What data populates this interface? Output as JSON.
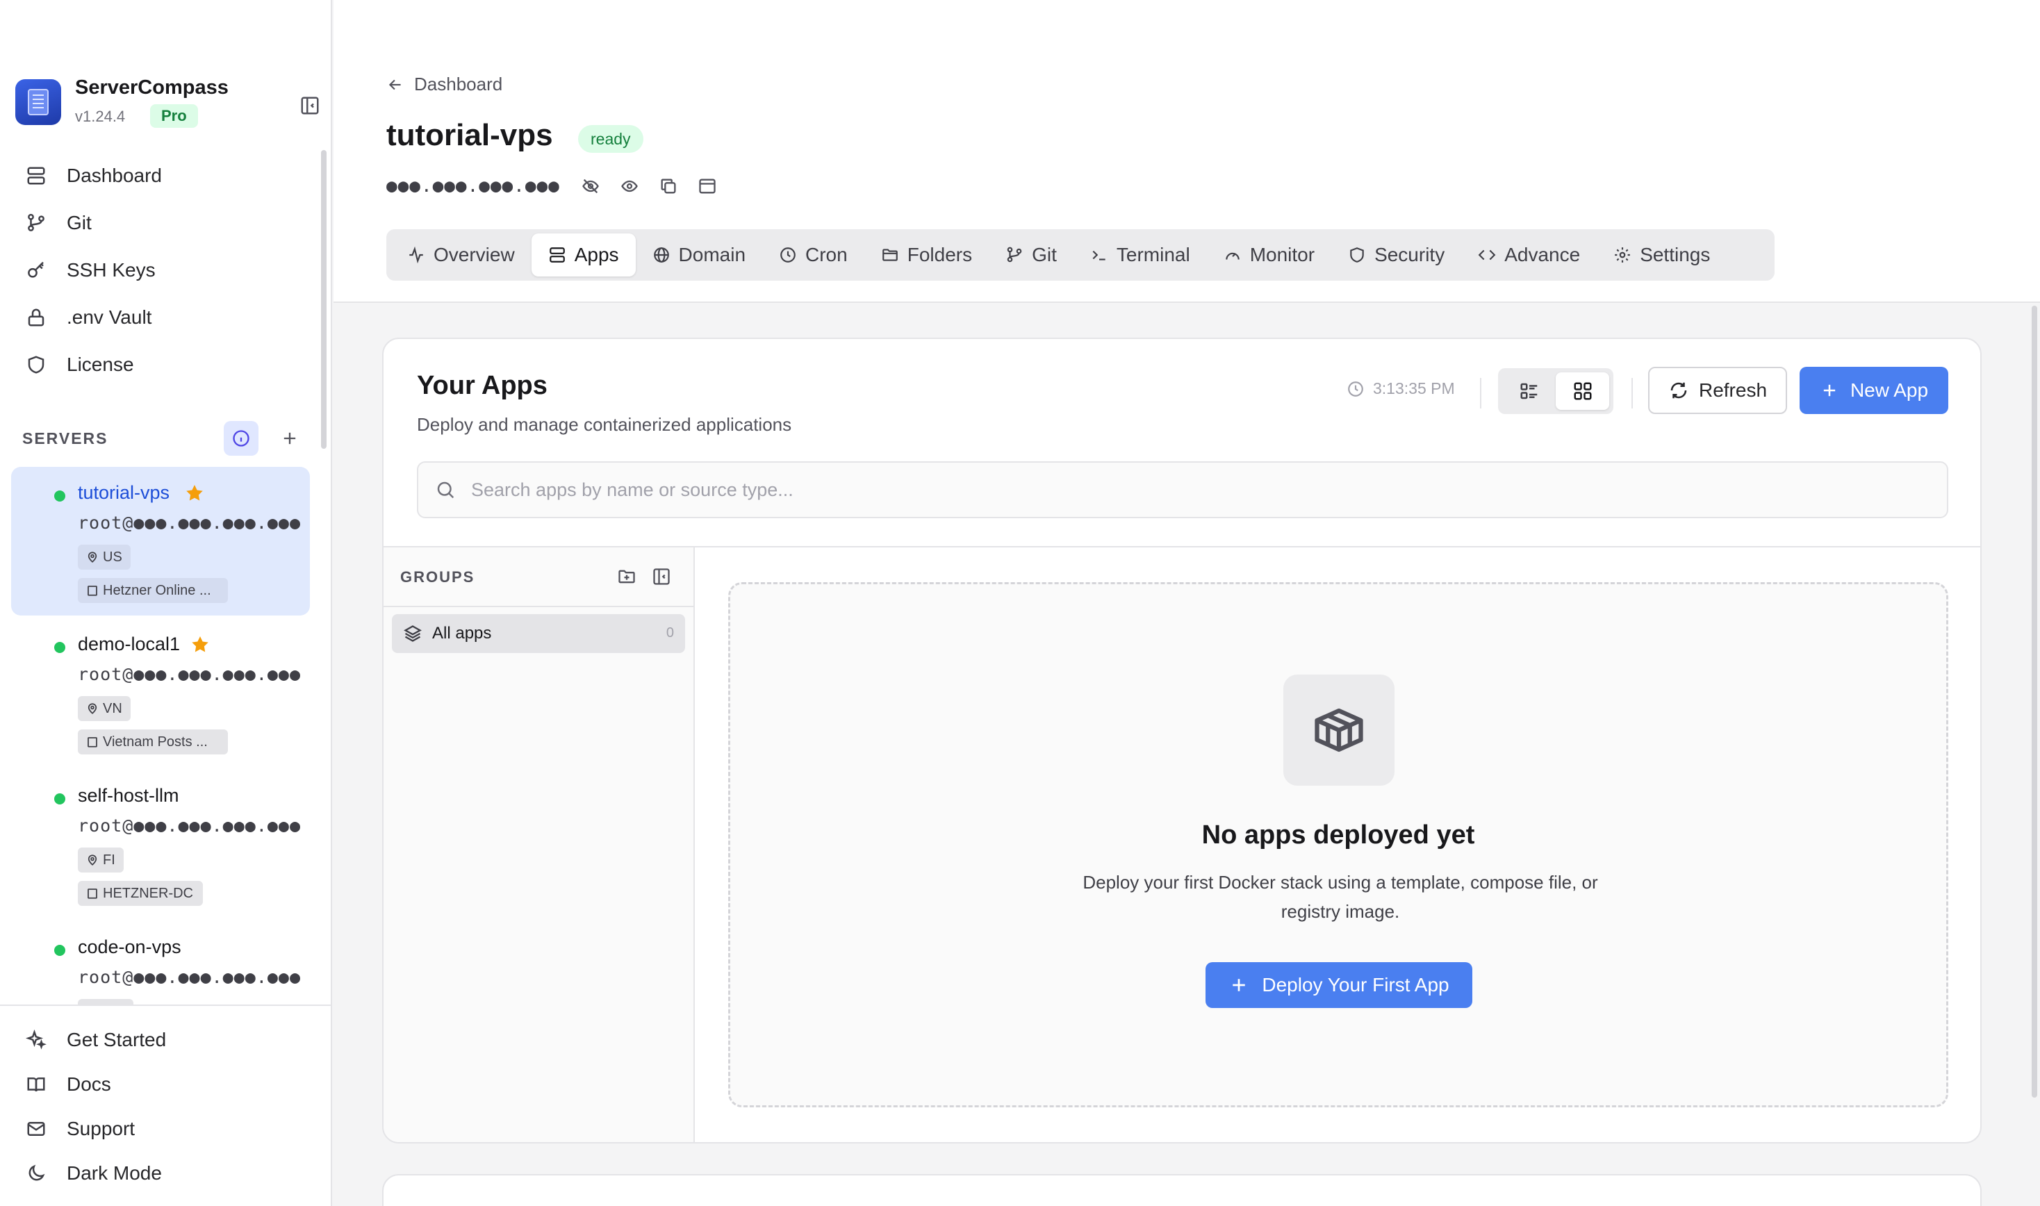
{
  "brand": {
    "name": "ServerCompass",
    "version": "v1.24.4",
    "plan": "Pro"
  },
  "nav": [
    {
      "label": "Dashboard",
      "icon": "server-icon"
    },
    {
      "label": "Git",
      "icon": "git-branch-icon"
    },
    {
      "label": "SSH Keys",
      "icon": "key-icon"
    },
    {
      "label": ".env Vault",
      "icon": "lock-icon"
    },
    {
      "label": "License",
      "icon": "shield-icon"
    }
  ],
  "servers_section": {
    "label": "SERVERS"
  },
  "servers": [
    {
      "name": "tutorial-vps",
      "user": "root@●●●.●●●.●●●.●●●",
      "location": "US",
      "provider": "Hetzner Online ...",
      "starred": true,
      "active": true
    },
    {
      "name": "demo-local1",
      "user": "root@●●●.●●●.●●●.●●●",
      "location": "VN",
      "provider": "Vietnam Posts ...",
      "starred": true,
      "active": false
    },
    {
      "name": "self-host-llm",
      "user": "root@●●●.●●●.●●●.●●●",
      "location": "FI",
      "provider": "HETZNER-DC",
      "starred": false,
      "active": false
    },
    {
      "name": "code-on-vps",
      "user": "root@●●●.●●●.●●●.●●●",
      "location": "",
      "provider": "",
      "starred": false,
      "active": false
    }
  ],
  "bottom_nav": [
    {
      "label": "Get Started",
      "icon": "sparkles-icon"
    },
    {
      "label": "Docs",
      "icon": "book-icon"
    },
    {
      "label": "Support",
      "icon": "mail-icon"
    },
    {
      "label": "Dark Mode",
      "icon": "moon-icon"
    }
  ],
  "header": {
    "back_label": "Dashboard",
    "title": "tutorial-vps",
    "status": "ready",
    "ip_masked": "●●●.●●●.●●●.●●●"
  },
  "tabs": [
    {
      "label": "Overview",
      "icon": "activity-icon",
      "active": false
    },
    {
      "label": "Apps",
      "icon": "stack-icon",
      "active": true
    },
    {
      "label": "Domain",
      "icon": "globe-icon",
      "active": false
    },
    {
      "label": "Cron",
      "icon": "clock-icon",
      "active": false
    },
    {
      "label": "Folders",
      "icon": "folder-icon",
      "active": false
    },
    {
      "label": "Git",
      "icon": "git-branch-icon",
      "active": false
    },
    {
      "label": "Terminal",
      "icon": "terminal-icon",
      "active": false
    },
    {
      "label": "Monitor",
      "icon": "gauge-icon",
      "active": false
    },
    {
      "label": "Security",
      "icon": "shield-icon",
      "active": false
    },
    {
      "label": "Advance",
      "icon": "code-icon",
      "active": false
    },
    {
      "label": "Settings",
      "icon": "gear-icon",
      "active": false
    }
  ],
  "apps": {
    "title": "Your Apps",
    "subtitle": "Deploy and manage containerized applications",
    "timestamp": "3:13:35 PM",
    "refresh_label": "Refresh",
    "new_app_label": "New App",
    "search_placeholder": "Search apps by name or source type...",
    "groups_label": "GROUPS",
    "groups": [
      {
        "label": "All apps",
        "count": "0"
      }
    ],
    "empty": {
      "title": "No apps deployed yet",
      "description": "Deploy your first Docker stack using a template, compose file, or registry image.",
      "button_label": "Deploy Your First App"
    }
  },
  "colors": {
    "accent": "#4a7ff0",
    "active_bg": "#e0e9fd",
    "success": "#22c55e",
    "star": "#f59e0b"
  }
}
